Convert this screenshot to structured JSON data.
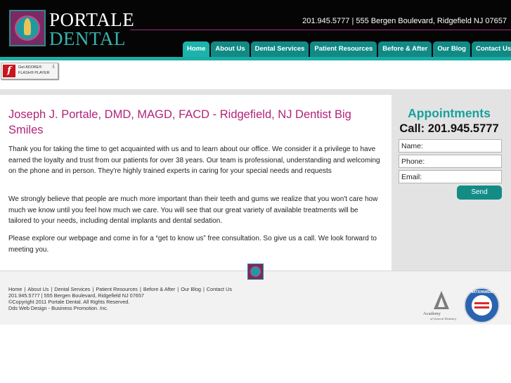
{
  "header": {
    "logo_line1": "PORTALE",
    "logo_line2": "DENTAL",
    "contact_line": "201.945.5777 | 555 Bergen Boulevard, Ridgefield NJ 07657"
  },
  "nav": {
    "items": [
      {
        "label": "Home",
        "active": true
      },
      {
        "label": "About Us",
        "active": false
      },
      {
        "label": "Dental Services",
        "active": false
      },
      {
        "label": "Patient Resources",
        "active": false
      },
      {
        "label": "Before & After",
        "active": false
      },
      {
        "label": "Our Blog",
        "active": false
      },
      {
        "label": "Contact Us",
        "active": false
      }
    ]
  },
  "flash_badge": {
    "line1": "Get ADOBE®",
    "line2": "FLASH® PLAYER"
  },
  "main": {
    "title": "Joseph J. Portale, DMD, MAGD, FACD - Ridgefield, NJ Dentist Big Smiles",
    "paragraphs": [
      "Thank you for taking the time to get acquainted with us and to learn about our office. We consider it a privilege to have earned the loyalty and trust from our patients for over 38 years. Our team is professional, understanding and welcoming on the phone and in person. They're highly trained experts in caring for your special needs and requests",
      "We strongly believe that people are much more important than their teeth and gums we realize that you won't care how much we know until you feel how much we care. You will see that our great variety of available treatments will be tailored to your needs, including dental implants and dental sedation.",
      "Please explore our webpage and come in for a “get to know us” free consultation. So give us a call. We look forward to meeting you."
    ]
  },
  "appointments": {
    "title": "Appointments",
    "call": "Call: 201.945.5777",
    "fields": {
      "name": "Name:",
      "phone": "Phone:",
      "email": "Email:"
    },
    "send_label": "Send"
  },
  "footer": {
    "links": [
      "Home",
      "About Us",
      "Dental Services",
      "Patient Resources",
      "Before & After",
      "Our Blog",
      "Contact Us"
    ],
    "contact": "201.945.5777 | 555 Bergen Boulevard, Ridgefield NJ 07657",
    "copyright": "©Copyright 2011 Portale Dental. All Rights Reserved.",
    "design": "Dds Web Design - Business Promotion. Inc.",
    "agd_line1": "Academy",
    "agd_line2": "of General Dentistry",
    "nationwide_label": "NATIONWIDE"
  },
  "colors": {
    "accent_teal": "#1aaca5",
    "title_magenta": "#b1237a",
    "header_bg": "#050505"
  },
  "icons": {
    "logo": "tooth-crest-logo",
    "flash": "adobe-flash-icon",
    "agd": "agd-triangle-logo",
    "nationwide": "nationwide-seal-logo"
  }
}
